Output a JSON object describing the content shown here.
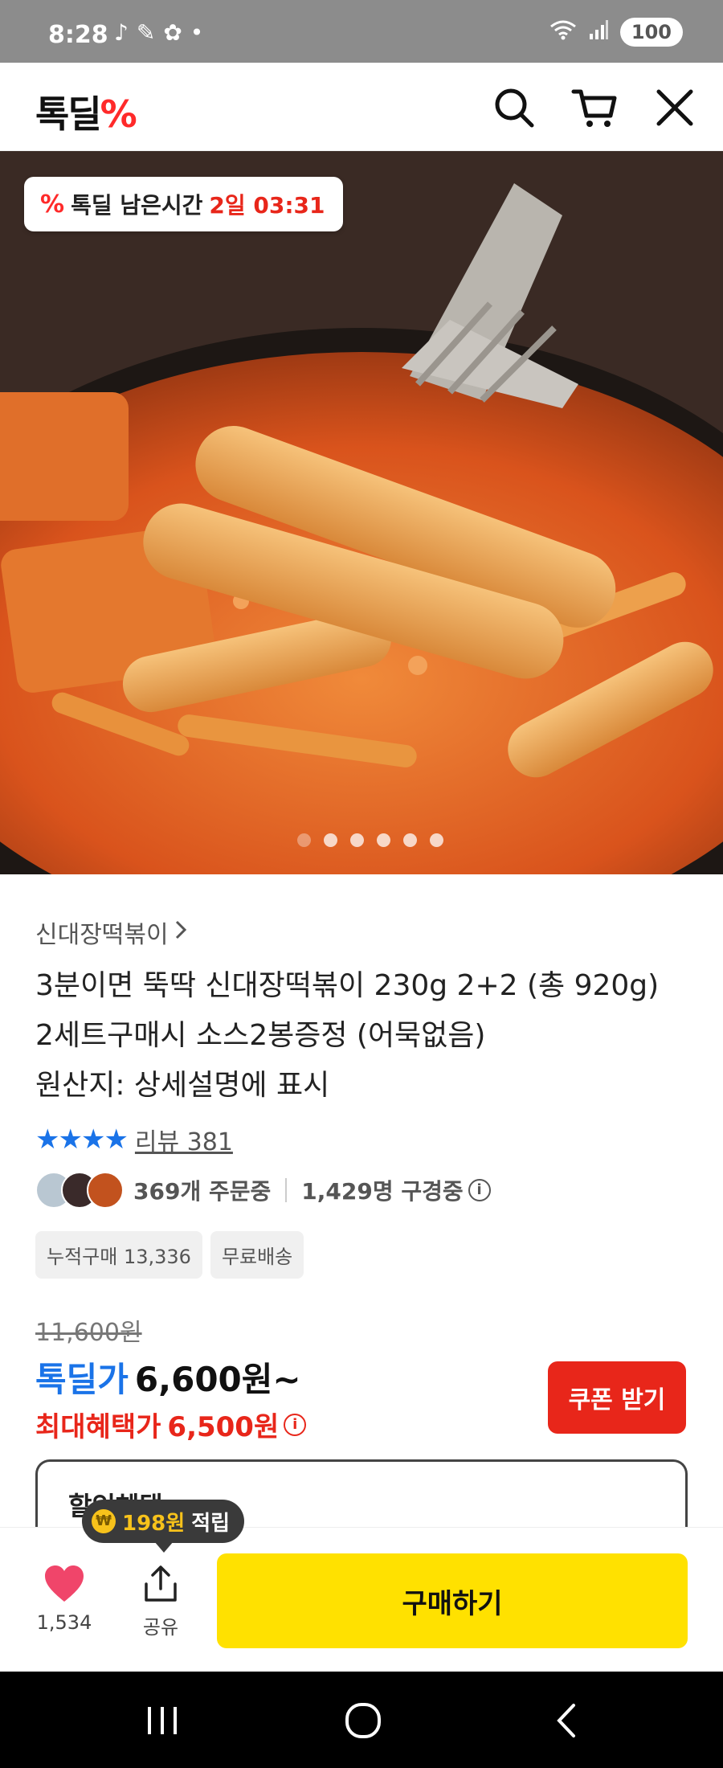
{
  "status_bar": {
    "time": "8:28",
    "battery": "100"
  },
  "header": {
    "logo_text": "톡딜",
    "logo_mark": "%",
    "icons": [
      "search-icon",
      "cart-icon",
      "close-icon"
    ]
  },
  "hero": {
    "timer_label": "톡딜 남은시간",
    "timer_value": "2일 03:31",
    "slide_count": 6,
    "active_slide": 1
  },
  "product": {
    "brand": "신대장떡볶이",
    "title_line1": "3분이면 뚝딱 신대장떡볶이 230g 2+2 (총 920g)",
    "title_line2": "2세트구매시 소스2봉증정 (어묵없음)",
    "title_line3": "원산지: 상세설명에 표시",
    "rating_stars": 4,
    "review_label": "리뷰 381",
    "orders": "369개 주문중",
    "viewers": "1,429명 구경중",
    "tags": [
      "누적구매 13,336",
      "무료배송"
    ],
    "original_price": "11,600원",
    "deal_label": "톡딜가",
    "deal_price": "6,600원~",
    "max_benefit_label": "최대혜택가",
    "max_benefit_price": "6,500원",
    "coupon_button": "쿠폰 받기",
    "discount_box_title": "할인혜택"
  },
  "bottom_bar": {
    "like_count": "1,534",
    "share_label": "공유",
    "points_amount": "198원",
    "points_label": "적립",
    "buy_button": "구매하기"
  },
  "colors": {
    "accent_red": "#e8261a",
    "accent_blue": "#1a73e8",
    "buy_yellow": "#ffe100",
    "like_pink": "#f0456a"
  }
}
